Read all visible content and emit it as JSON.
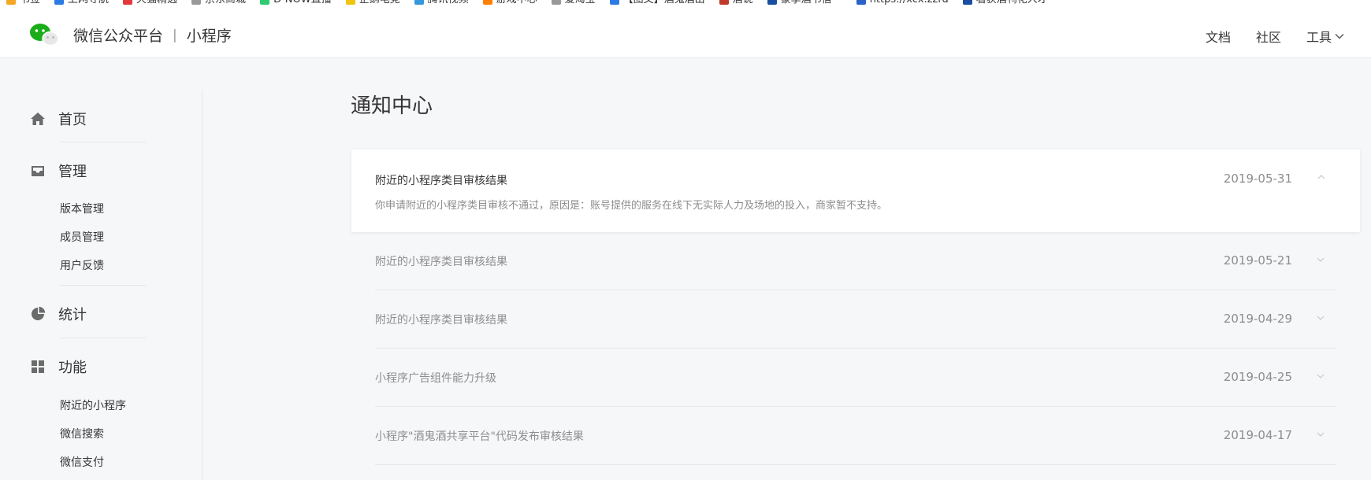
{
  "bookmarks": [
    {
      "label": "书签",
      "color": "#f5a623"
    },
    {
      "label": "上网导航",
      "color": "#2c7be5"
    },
    {
      "label": "天猫精选",
      "color": "#e4393c"
    },
    {
      "label": "京东商城",
      "color": "#999999"
    },
    {
      "label": "D-NOW直播",
      "color": "#2ecc71"
    },
    {
      "label": "企鹅电竞",
      "color": "#f1c40f"
    },
    {
      "label": "腾讯视频",
      "color": "#3498db"
    },
    {
      "label": "游戏中心",
      "color": "#ff7f00"
    },
    {
      "label": "爱淘宝",
      "color": "#999999"
    },
    {
      "label": "【图文】酒鬼酒出",
      "color": "#2c7be5"
    },
    {
      "label": "酒说",
      "color": "#c0392b"
    },
    {
      "label": "豪享酒书信一",
      "color": "#1a4ea3"
    },
    {
      "label": "https://xcx.zzrd",
      "color": "#2a62c9"
    },
    {
      "label": "看获酒鸭花人才",
      "color": "#1a4ea3"
    }
  ],
  "header": {
    "brand": "微信公众平台",
    "separator": "|",
    "product": "小程序",
    "nav": {
      "docs": "文档",
      "community": "社区",
      "tools": "工具"
    }
  },
  "sidebar": {
    "home": "首页",
    "manage": "管理",
    "manage_items": [
      "版本管理",
      "成员管理",
      "用户反馈"
    ],
    "stats": "统计",
    "features": "功能",
    "feature_items": [
      "附近的小程序",
      "微信搜索",
      "微信支付"
    ]
  },
  "page": {
    "title": "通知中心"
  },
  "notices": [
    {
      "title": "附近的小程序类目审核结果",
      "date": "2019-05-31",
      "content": "你申请附近的小程序类目审核不通过，原因是：账号提供的服务在线下无实际人力及场地的投入，商家暂不支持。"
    },
    {
      "title": "附近的小程序类目审核结果",
      "date": "2019-05-21"
    },
    {
      "title": "附近的小程序类目审核结果",
      "date": "2019-04-29"
    },
    {
      "title": "小程序广告组件能力升级",
      "date": "2019-04-25"
    },
    {
      "title": "小程序\"酒鬼酒共享平台\"代码发布审核结果",
      "date": "2019-04-17"
    }
  ],
  "colors": {
    "brand_green": "#1aad19",
    "text": "#353535",
    "muted": "#8d8d8d",
    "divider": "#e7e7eb"
  }
}
